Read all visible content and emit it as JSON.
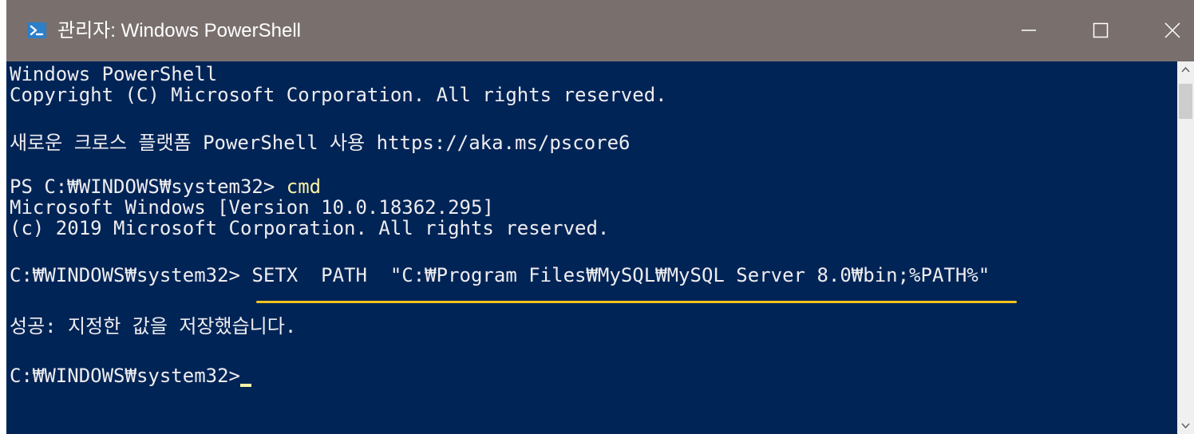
{
  "window": {
    "title": "관리자: Windows PowerShell",
    "icon": "powershell-icon",
    "controls": {
      "minimize": "minimize-icon",
      "maximize": "maximize-icon",
      "close": "close-icon"
    }
  },
  "console": {
    "lines": {
      "l1": "Windows PowerShell",
      "l2": "Copyright (C) Microsoft Corporation. All rights reserved.",
      "l3": "새로운 크로스 플랫폼 PowerShell 사용 https://aka.ms/pscore6",
      "l4_prompt": "PS C:₩WINDOWS₩system32> ",
      "l4_command": "cmd",
      "l5": "Microsoft Windows [Version 10.0.18362.295]",
      "l6": "(c) 2019 Microsoft Corporation. All rights reserved.",
      "l7_prompt": "C:₩WINDOWS₩system32> ",
      "l7_command": "SETX  PATH  \"C:₩Program Files₩MySQL₩MySQL Server 8.0₩bin;%PATH%\"",
      "l8": "성공: 지정한 값을 저장했습니다.",
      "l9_prompt": "C:₩WINDOWS₩system32>"
    }
  },
  "colors": {
    "console_background": "#012456",
    "console_text": "#eeedf0",
    "command_highlight": "#f9f1a5",
    "annotation_underline": "#f2c21b",
    "titlebar": "#79706e"
  }
}
